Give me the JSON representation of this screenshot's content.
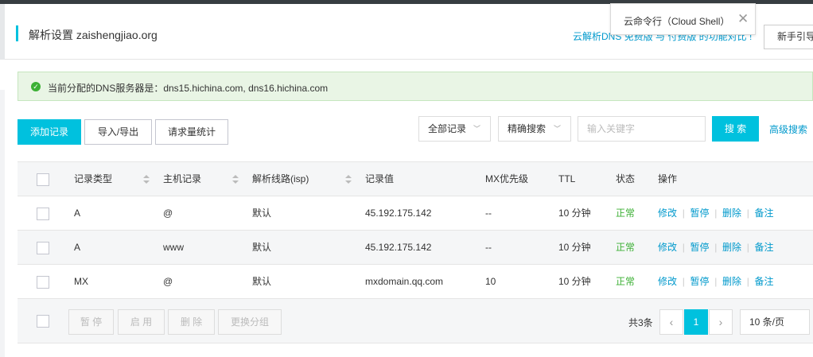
{
  "header": {
    "title": "解析设置 zaishengjiao.org",
    "compare_link": "云解析DNS 免费版 与 付费版 的功能对比 !",
    "guide_button": "新手引导"
  },
  "popup": {
    "text": "云命令行（Cloud Shell）",
    "close_icon": "close-icon"
  },
  "notice": {
    "icon": "check-circle-icon",
    "text": "当前分配的DNS服务器是：dns15.hichina.com, dns16.hichina.com"
  },
  "toolbar": {
    "add_record": "添加记录",
    "import_export": "导入/导出",
    "request_stats": "请求量统计",
    "record_filter": "全部记录",
    "search_mode": "精确搜索",
    "search_placeholder": "输入关键字",
    "search_button": "搜 索",
    "advanced_search": "高级搜索"
  },
  "table": {
    "columns": [
      "记录类型",
      "主机记录",
      "解析线路(isp)",
      "记录值",
      "MX优先级",
      "TTL",
      "状态",
      "操作"
    ],
    "rows": [
      {
        "type": "A",
        "host": "@",
        "line": "默认",
        "value": "45.192.175.142",
        "mx": "--",
        "ttl": "10 分钟",
        "status": "正常"
      },
      {
        "type": "A",
        "host": "www",
        "line": "默认",
        "value": "45.192.175.142",
        "mx": "--",
        "ttl": "10 分钟",
        "status": "正常"
      },
      {
        "type": "MX",
        "host": "@",
        "line": "默认",
        "value": "mxdomain.qq.com",
        "mx": "10",
        "ttl": "10 分钟",
        "status": "正常"
      }
    ],
    "actions": {
      "edit": "修改",
      "pause": "暂停",
      "delete": "删除",
      "note": "备注"
    }
  },
  "footer": {
    "pause": "暂 停",
    "enable": "启 用",
    "delete": "删 除",
    "change_group": "更换分组",
    "total": "共3条",
    "prev": "‹",
    "current_page": "1",
    "next": "›",
    "page_size": "10 条/页"
  },
  "colors": {
    "accent": "#00c1de",
    "link": "#0099cc",
    "status_ok": "#3cb035"
  }
}
